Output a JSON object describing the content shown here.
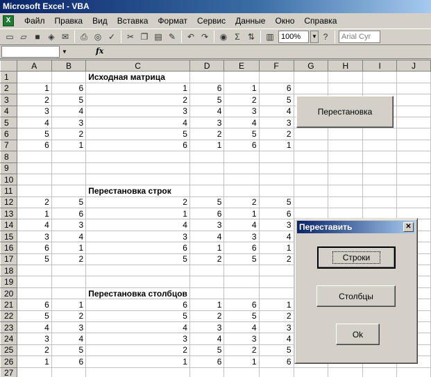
{
  "window": {
    "title": "Microsoft Excel - VBA"
  },
  "menu": [
    "Файл",
    "Правка",
    "Вид",
    "Вставка",
    "Формат",
    "Сервис",
    "Данные",
    "Окно",
    "Справка"
  ],
  "toolbar": {
    "zoom": "100%",
    "font": "Arial Cyr",
    "icons": [
      "new-icon",
      "open-icon",
      "save-icon",
      "permission-icon",
      "email-icon",
      "print-icon",
      "print-preview-icon",
      "spelling-icon",
      "cut-icon",
      "copy-icon",
      "paste-icon",
      "format-painter-icon",
      "undo-icon",
      "redo-icon",
      "hyperlink-icon",
      "autosum-icon",
      "sort-icon",
      "chart-icon",
      "help-icon"
    ]
  },
  "formula_bar": {
    "name_box": "",
    "fx": "fx"
  },
  "columns": [
    "A",
    "B",
    "C",
    "D",
    "E",
    "F",
    "G",
    "H",
    "I",
    "J"
  ],
  "sheet": {
    "titles": {
      "1": "Исходная матрица",
      "11": "Перестановка строк",
      "20": "Перестановка столбцов"
    },
    "rows": [
      {
        "n": "1",
        "cells": []
      },
      {
        "n": "2",
        "cells": [
          "1",
          "6",
          "1",
          "6",
          "1",
          "6"
        ]
      },
      {
        "n": "3",
        "cells": [
          "2",
          "5",
          "2",
          "5",
          "2",
          "5"
        ]
      },
      {
        "n": "4",
        "cells": [
          "3",
          "4",
          "3",
          "4",
          "3",
          "4"
        ]
      },
      {
        "n": "5",
        "cells": [
          "4",
          "3",
          "4",
          "3",
          "4",
          "3"
        ]
      },
      {
        "n": "6",
        "cells": [
          "5",
          "2",
          "5",
          "2",
          "5",
          "2"
        ]
      },
      {
        "n": "7",
        "cells": [
          "6",
          "1",
          "6",
          "1",
          "6",
          "1"
        ]
      },
      {
        "n": "8",
        "cells": []
      },
      {
        "n": "9",
        "cells": []
      },
      {
        "n": "10",
        "cells": []
      },
      {
        "n": "11",
        "cells": []
      },
      {
        "n": "12",
        "cells": [
          "2",
          "5",
          "2",
          "5",
          "2",
          "5"
        ]
      },
      {
        "n": "13",
        "cells": [
          "1",
          "6",
          "1",
          "6",
          "1",
          "6"
        ]
      },
      {
        "n": "14",
        "cells": [
          "4",
          "3",
          "4",
          "3",
          "4",
          "3"
        ]
      },
      {
        "n": "15",
        "cells": [
          "3",
          "4",
          "3",
          "4",
          "3",
          "4"
        ]
      },
      {
        "n": "16",
        "cells": [
          "6",
          "1",
          "6",
          "1",
          "6",
          "1"
        ]
      },
      {
        "n": "17",
        "cells": [
          "5",
          "2",
          "5",
          "2",
          "5",
          "2"
        ]
      },
      {
        "n": "18",
        "cells": []
      },
      {
        "n": "19",
        "cells": []
      },
      {
        "n": "20",
        "cells": []
      },
      {
        "n": "21",
        "cells": [
          "6",
          "1",
          "6",
          "1",
          "6",
          "1"
        ]
      },
      {
        "n": "22",
        "cells": [
          "5",
          "2",
          "5",
          "2",
          "5",
          "2"
        ]
      },
      {
        "n": "23",
        "cells": [
          "4",
          "3",
          "4",
          "3",
          "4",
          "3"
        ]
      },
      {
        "n": "24",
        "cells": [
          "3",
          "4",
          "3",
          "4",
          "3",
          "4"
        ]
      },
      {
        "n": "25",
        "cells": [
          "2",
          "5",
          "2",
          "5",
          "2",
          "5"
        ]
      },
      {
        "n": "26",
        "cells": [
          "1",
          "6",
          "1",
          "6",
          "1",
          "6"
        ]
      },
      {
        "n": "27",
        "cells": []
      }
    ]
  },
  "sheet_button": {
    "label": "Перестановка"
  },
  "dialog": {
    "title": "Переставить",
    "close": "✕",
    "rows_button": "Строки",
    "cols_button": "Столбцы",
    "ok_button": "Ok"
  }
}
